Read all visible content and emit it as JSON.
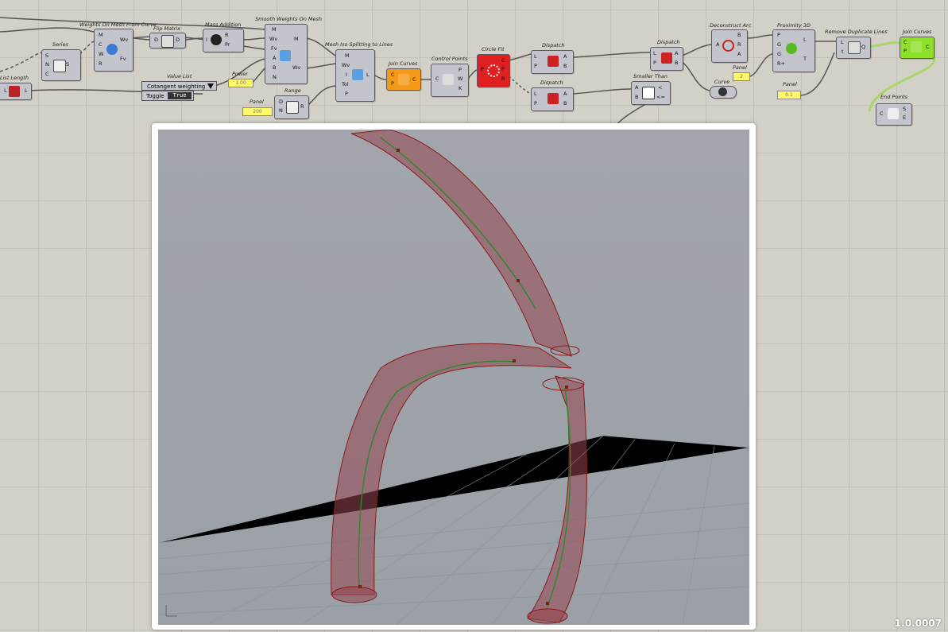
{
  "version": "1.0.0007",
  "components": {
    "list_length": {
      "title": "List Length",
      "in": "L",
      "out": "L"
    },
    "series": {
      "title": "Series",
      "in": [
        "S",
        "N",
        "C"
      ],
      "out": "S"
    },
    "weights_on_mesh": {
      "title": "Weights On Mesh From Curve",
      "in": [
        "M",
        "C",
        "W",
        "R"
      ],
      "out": [
        "Wv",
        "Fv"
      ]
    },
    "flip_matrix": {
      "title": "Flip Matrix",
      "in": "D",
      "out": "D"
    },
    "mass_addition": {
      "title": "Mass Addition",
      "in": "I",
      "out": [
        "R",
        "Pr"
      ]
    },
    "smooth_weights": {
      "title": "Smooth Weights On Mesh",
      "in": [
        "M",
        "Wv",
        "Fv",
        "A",
        "B",
        "N"
      ],
      "out": [
        "M",
        "Wv"
      ]
    },
    "mesh_iso": {
      "title": "Mesh Iso Splitting to Lines",
      "in": [
        "M",
        "Wv",
        "I",
        "Tol",
        "P"
      ],
      "out": "L"
    },
    "join_curves_1": {
      "title": "Join Curves",
      "in": [
        "C",
        "P"
      ],
      "out": "C"
    },
    "control_points": {
      "title": "Control Points",
      "in": "C",
      "out": [
        "P",
        "W",
        "K"
      ]
    },
    "circle_fit": {
      "title": "Circle Fit",
      "in": "P",
      "out": [
        "C",
        "P",
        "R"
      ]
    },
    "dispatch_1": {
      "title": "Dispatch",
      "in": [
        "L",
        "P"
      ],
      "out": [
        "A",
        "B"
      ]
    },
    "dispatch_2": {
      "title": "Dispatch",
      "in": [
        "L",
        "P"
      ],
      "out": [
        "A",
        "B"
      ]
    },
    "dispatch_3": {
      "title": "Dispatch",
      "in": [
        "L",
        "P"
      ],
      "out": [
        "A",
        "B"
      ]
    },
    "smaller_than": {
      "title": "Smaller Than",
      "in": [
        "A",
        "B"
      ],
      "out": [
        "<",
        "<="
      ]
    },
    "deconstruct_arc": {
      "title": "Deconstruct Arc",
      "in": "A",
      "out": [
        "B",
        "R",
        "A"
      ]
    },
    "curve": {
      "title": "Curve"
    },
    "proximity_3d": {
      "title": "Proximity 3D",
      "in": [
        "P",
        "G",
        "G",
        "R+"
      ],
      "out": [
        "L",
        "T"
      ]
    },
    "remove_dup": {
      "title": "Remove Duplicate Lines",
      "in": [
        "L",
        "t"
      ],
      "out": "Q"
    },
    "join_curves_2": {
      "title": "Join Curves",
      "in": [
        "C",
        "P"
      ],
      "out": "C"
    },
    "end_points": {
      "title": "End Points",
      "in": "C",
      "out": [
        "S",
        "E"
      ]
    },
    "range": {
      "title": "Range",
      "in": [
        "D",
        "N"
      ],
      "out": "R"
    }
  },
  "panels": {
    "panel_top": {
      "title": "Panel",
      "value": "0.5"
    },
    "panel_left": {
      "title": "Panel",
      "value": "200"
    },
    "panel_mid": {
      "title": "Panel",
      "value": "2"
    },
    "panel_right": {
      "title": "Panel",
      "value": "0.1"
    },
    "panel_power": {
      "title": "Power",
      "value": "1.00"
    }
  },
  "value_list": {
    "title": "Value List",
    "selected": "Cotangent weighting"
  },
  "toggle": {
    "label": "Toggle",
    "value": "True"
  }
}
